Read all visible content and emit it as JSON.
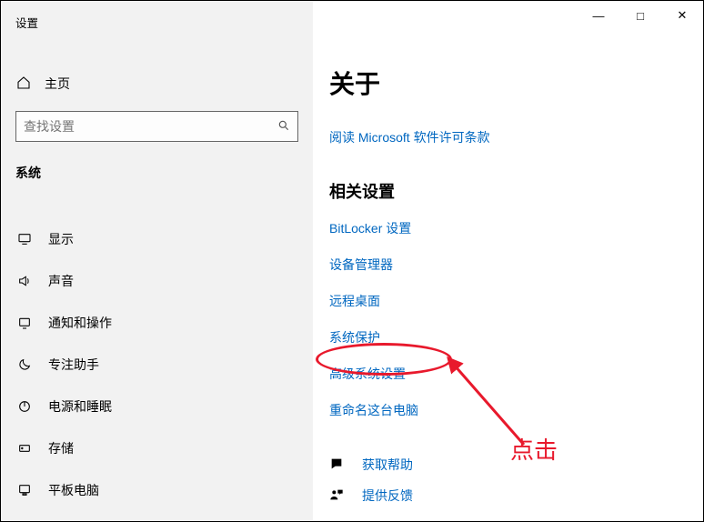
{
  "window": {
    "title": "设置",
    "controls": {
      "min": "—",
      "max": "□",
      "close": "✕"
    }
  },
  "sidebar": {
    "home_label": "主页",
    "search_placeholder": "查找设置",
    "category_label": "系统",
    "items": [
      {
        "label": "显示"
      },
      {
        "label": "声音"
      },
      {
        "label": "通知和操作"
      },
      {
        "label": "专注助手"
      },
      {
        "label": "电源和睡眠"
      },
      {
        "label": "存储"
      },
      {
        "label": "平板电脑"
      }
    ]
  },
  "main": {
    "title": "关于",
    "license_link": "阅读 Microsoft 软件许可条款",
    "related_heading": "相关设置",
    "related_links": [
      "BitLocker 设置",
      "设备管理器",
      "远程桌面",
      "系统保护",
      "高级系统设置",
      "重命名这台电脑"
    ],
    "help_section": [
      "获取帮助",
      "提供反馈"
    ]
  },
  "annotation": {
    "label": "点击",
    "color": "#e8192c"
  }
}
